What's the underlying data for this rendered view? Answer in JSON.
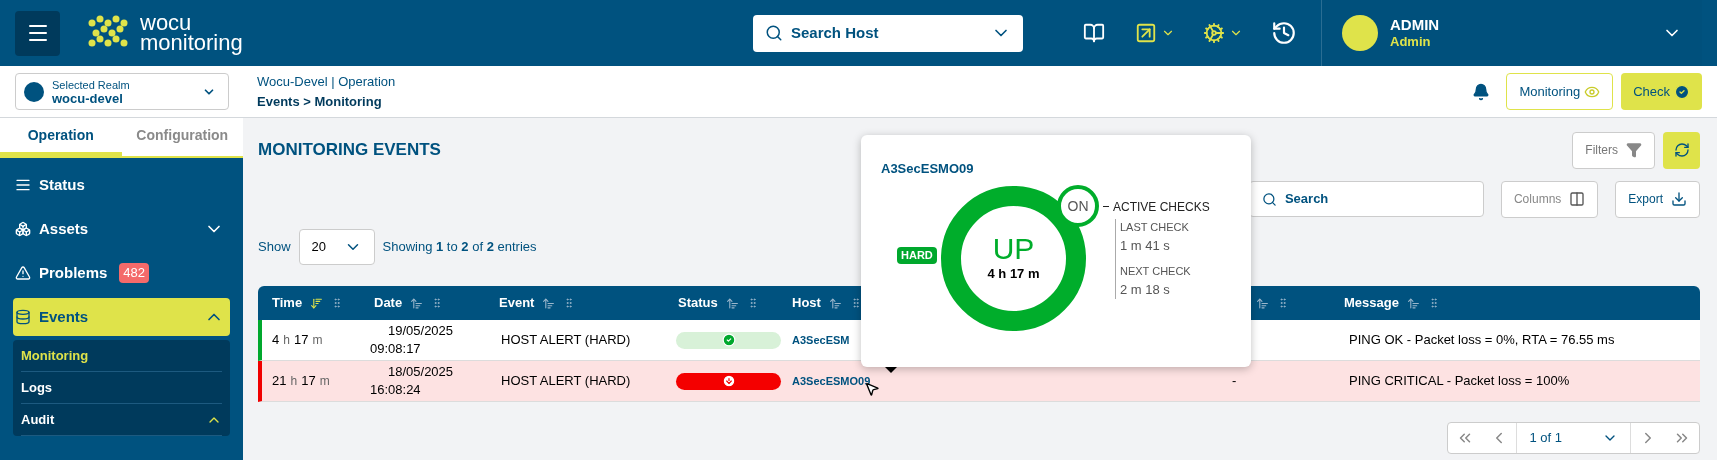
{
  "topbar": {
    "logo_top": "wocu",
    "logo_bottom": "monitoring",
    "search_host": {
      "placeholder": "Search Host"
    },
    "user": {
      "name": "ADMIN",
      "role": "Admin"
    }
  },
  "realm": {
    "label": "Selected Realm",
    "value": "wocu-devel"
  },
  "breadcrumb": {
    "top": "Wocu-Devel | Operation",
    "bottom": "Events > Monitoring"
  },
  "header_buttons": [
    {
      "label": "Monitoring",
      "kind": "outline"
    },
    {
      "label": "Check",
      "kind": "filled"
    }
  ],
  "sidebar": {
    "tabs": [
      {
        "label": "Operation",
        "selected": true
      },
      {
        "label": "Configuration",
        "selected": false
      }
    ],
    "items": [
      {
        "label": "Status",
        "kind": "list",
        "selected": false
      },
      {
        "label": "Assets",
        "kind": "cubes",
        "expanded": false,
        "selected": false
      },
      {
        "label": "Problems",
        "kind": "warning",
        "badge": "482",
        "selected": false
      },
      {
        "label": "Events",
        "kind": "database",
        "expanded": true,
        "selected": true,
        "children": [
          {
            "label": "Monitoring",
            "selected": true
          },
          {
            "label": "Logs",
            "selected": false
          },
          {
            "label": "Audit",
            "selected": false,
            "expanded": true
          }
        ]
      }
    ]
  },
  "page": {
    "title": "MONITORING EVENTS",
    "filters": "Filters",
    "search": {
      "placeholder": "Search"
    },
    "columns_button": "Columns",
    "export_button": "Export",
    "show_label": "Show",
    "page_size": "20",
    "showing": "Showing **1** to **2** of **2** entries"
  },
  "table": {
    "columns": [
      {
        "label": "Time",
        "sorted": true
      },
      {
        "label": "Date",
        "sorted": false
      },
      {
        "label": "Event",
        "sorted": false
      },
      {
        "label": "Status",
        "sorted": false
      },
      {
        "label": "Host",
        "sorted": false
      },
      {
        "sorted": false
      },
      {
        "label": "Message",
        "sorted": false
      }
    ],
    "rows": [
      {
        "kind": "ok",
        "time": [
          "4",
          "h",
          "17",
          "m"
        ],
        "date": "19/05/2025",
        "clock": "09:08:17",
        "event": "HOST ALERT (HARD)",
        "host": "A3SecESM",
        "message": "PING OK - Packet loss = 0%, RTA = 76.55 ms"
      },
      {
        "kind": "critical",
        "time": [
          "21",
          "h",
          "17",
          "m"
        ],
        "date": "18/05/2025",
        "clock": "16:08:24",
        "event": "HOST ALERT (HARD)",
        "host": "A3SecESMO09",
        "column_6": "-",
        "message": "PING CRITICAL - Packet loss = 100%"
      }
    ]
  },
  "pagination": {
    "page": "1 of 1"
  },
  "popup": {
    "host": "A3SecESMO09",
    "state": "UP",
    "duration": "4 h 17 m",
    "badge": "HARD",
    "active": "ON",
    "active_label": "ACTIVE CHECKS",
    "last_check_label": "LAST CHECK",
    "last_check": "1 m 41 s",
    "next_check_label": "NEXT CHECK",
    "next_check": "2 m 18 s"
  }
}
